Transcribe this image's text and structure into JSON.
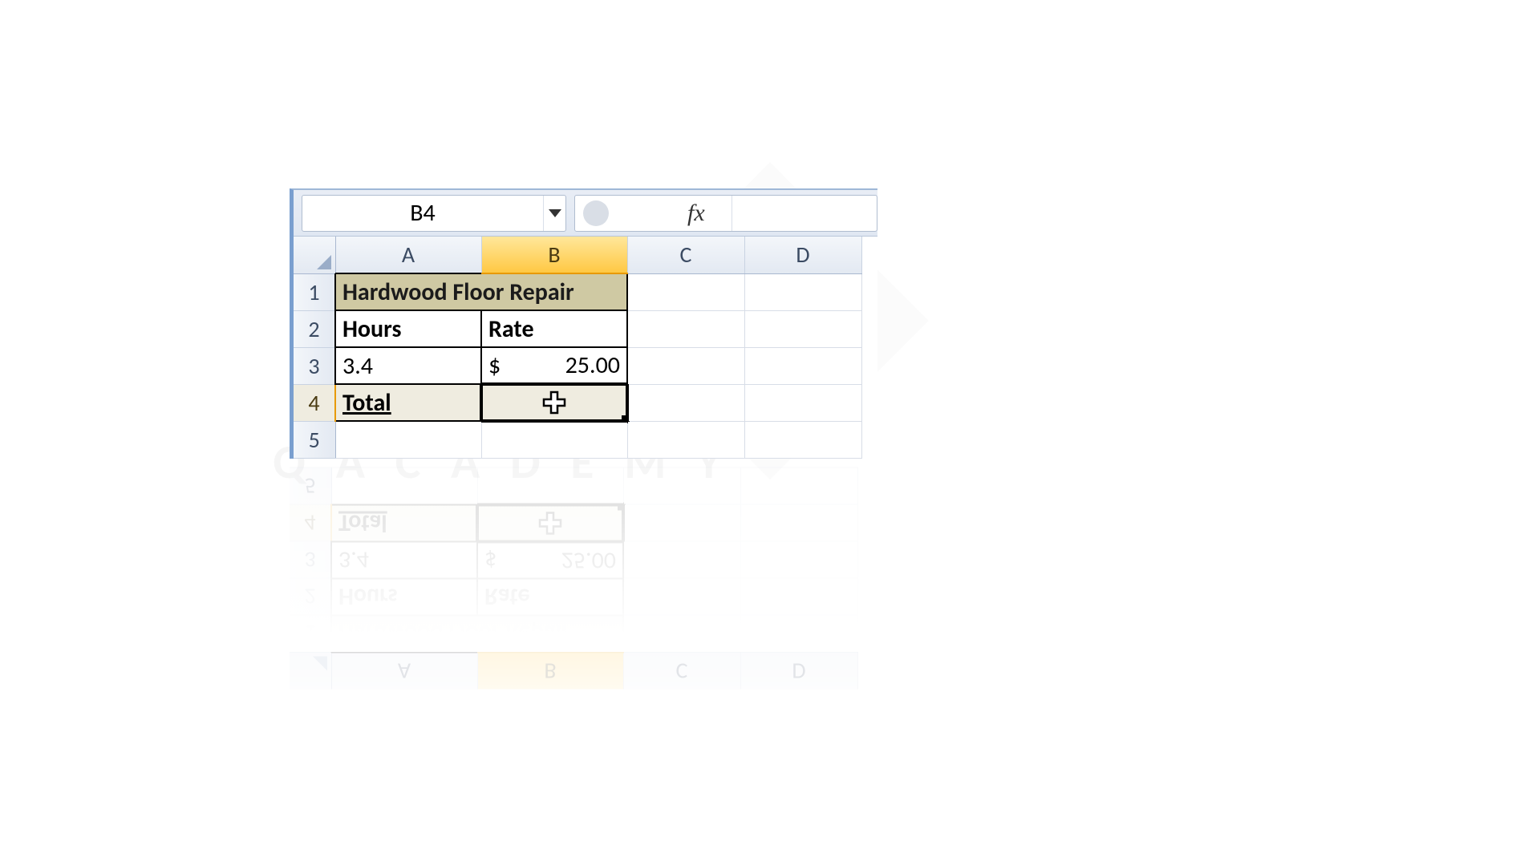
{
  "namebox": {
    "cell_ref": "B4"
  },
  "formula_bar": {
    "fx_label": "fx",
    "value": ""
  },
  "columns": [
    "A",
    "B",
    "C",
    "D"
  ],
  "rows": [
    "1",
    "2",
    "3",
    "4",
    "5"
  ],
  "active": {
    "col": "B",
    "row": "4"
  },
  "data": {
    "title": "Hardwood Floor Repair",
    "hours_label": "Hours",
    "rate_label": "Rate",
    "hours_value": "3.4",
    "rate_currency": "$",
    "rate_value": "25.00",
    "total_label": "Total",
    "total_value": ""
  },
  "watermark": "Q  A C A D E M Y"
}
